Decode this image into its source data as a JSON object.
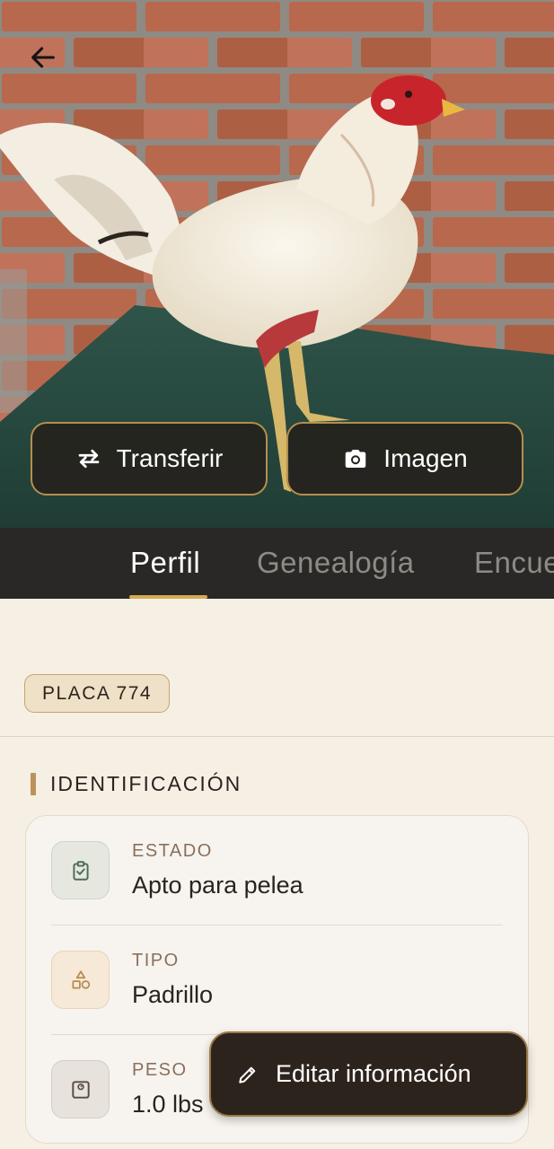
{
  "header": {
    "back_icon": "arrow-left-icon",
    "photo_alt": "Gallo blanco",
    "buttons": {
      "transfer": {
        "label": "Transferir",
        "icon": "swap-arrows-icon"
      },
      "image": {
        "label": "Imagen",
        "icon": "camera-icon"
      }
    }
  },
  "tabs": [
    {
      "label": "Perfil",
      "active": true
    },
    {
      "label": "Genealogía",
      "active": false
    },
    {
      "label": "Encue",
      "active": false
    }
  ],
  "profile": {
    "badge": "PLACA 774",
    "section_title": "IDENTIFICACIÓN",
    "rows": [
      {
        "label": "ESTADO",
        "value": "Apto para pelea",
        "icon": "clipboard-check-icon"
      },
      {
        "label": "TIPO",
        "value": "Padrillo",
        "icon": "shapes-icon"
      },
      {
        "label": "PESO",
        "value": "1.0 lbs",
        "icon": "scale-icon"
      }
    ]
  },
  "fab": {
    "label": "Editar información",
    "icon": "pencil-icon"
  },
  "colors": {
    "accent_gold": "#d4ab53",
    "dark_bar": "#2a2826",
    "background": "#f6efe4"
  }
}
